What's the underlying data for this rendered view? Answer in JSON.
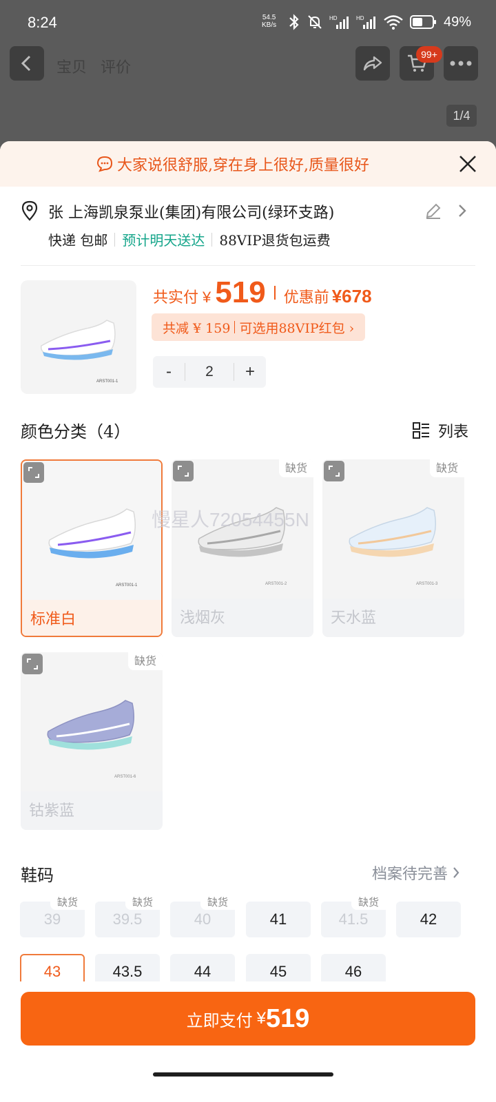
{
  "status_bar": {
    "time": "8:24",
    "net_speed_value": "54.5",
    "net_speed_unit": "KB/s",
    "wifi_label": "6",
    "battery": "49%"
  },
  "header": {
    "tabs": [
      "宝贝",
      "评价"
    ],
    "cart_badge": "99+",
    "image_counter": "1/4"
  },
  "sheet": {
    "review_banner": "大家说很舒服,穿在身上很好,质量很好",
    "address": "张 上海凯泉泵业(集团)有限公司(绿环支路)",
    "shipping": {
      "method": "快递 包邮",
      "eta": "预计明天送达",
      "vip": "88VIP退货包运费"
    },
    "price": {
      "label": "共实付",
      "currency": "¥",
      "amount": "519",
      "original_label": "优惠前",
      "original": "¥678"
    },
    "discount": {
      "saved": "共减 ¥ 159",
      "vip_packet": "可选用88VIP红包 ›"
    },
    "quantity": {
      "minus": "-",
      "value": "2",
      "plus": "+"
    },
    "product_thumb_code": "ARST001-1",
    "colors_section": {
      "title": "颜色分类（4）",
      "view_toggle": "列表",
      "items": [
        {
          "label": "标准白",
          "code": "ARST001-1",
          "stock": "",
          "selected": true
        },
        {
          "label": "浅烟灰",
          "code": "ARST001-2",
          "stock": "缺货",
          "selected": false
        },
        {
          "label": "天水蓝",
          "code": "ARST001-3",
          "stock": "缺货",
          "selected": false
        },
        {
          "label": "钴紫蓝",
          "code": "ARST001-6",
          "stock": "缺货",
          "selected": false
        }
      ]
    },
    "watermark": "慢星人72054455N",
    "sizes_section": {
      "title": "鞋码",
      "profile_link": "档案待完善",
      "items": [
        {
          "label": "39",
          "stock": "缺货",
          "state": "disabled"
        },
        {
          "label": "39.5",
          "stock": "缺货",
          "state": "disabled"
        },
        {
          "label": "40",
          "stock": "缺货",
          "state": "disabled"
        },
        {
          "label": "41",
          "stock": "",
          "state": "normal"
        },
        {
          "label": "41.5",
          "stock": "缺货",
          "state": "disabled"
        },
        {
          "label": "42",
          "stock": "",
          "state": "normal"
        },
        {
          "label": "43",
          "stock": "",
          "state": "selected"
        },
        {
          "label": "43.5",
          "stock": "",
          "state": "normal"
        },
        {
          "label": "44",
          "stock": "",
          "state": "normal"
        },
        {
          "label": "45",
          "stock": "",
          "state": "normal"
        },
        {
          "label": "46",
          "stock": "",
          "state": "normal"
        }
      ]
    },
    "pay_button": {
      "label": "立即支付",
      "currency": "¥",
      "amount": "519"
    }
  },
  "colors": {
    "accent": "#f86512",
    "price_orange": "#f05a1a",
    "green": "#14a58a"
  }
}
